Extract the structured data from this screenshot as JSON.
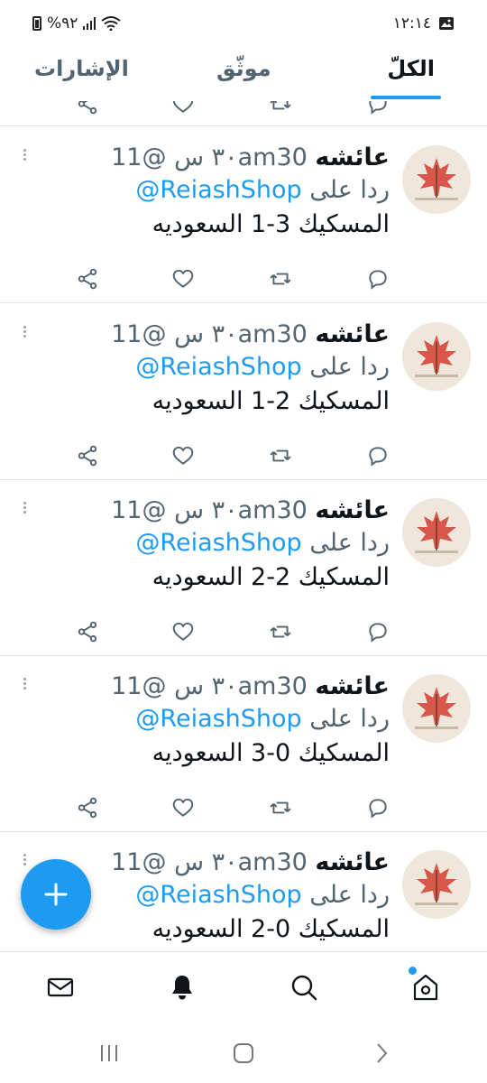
{
  "status_bar": {
    "time": "١٢:١٤",
    "battery": "%٩٢"
  },
  "tabs": [
    {
      "label": "الكلّ"
    },
    {
      "label": "موثّق"
    },
    {
      "label": "الإشارات"
    }
  ],
  "tweets": [
    {
      "name": "عائشه",
      "handle": "@11am30",
      "time": "٣٠ س",
      "reply_prefix": "ردا على",
      "mention": "@ReiashShop",
      "text": "المسكيك 3-1 السعوديه"
    },
    {
      "name": "عائشه",
      "handle": "@11am30",
      "time": "٣٠ س",
      "reply_prefix": "ردا على",
      "mention": "@ReiashShop",
      "text": "المسكيك 2-1 السعوديه"
    },
    {
      "name": "عائشه",
      "handle": "@11am30",
      "time": "٣٠ س",
      "reply_prefix": "ردا على",
      "mention": "@ReiashShop",
      "text": "المسكيك 2-2 السعوديه"
    },
    {
      "name": "عائشه",
      "handle": "@11am30",
      "time": "٣٠ س",
      "reply_prefix": "ردا على",
      "mention": "@ReiashShop",
      "text": "المسكيك 0-3 السعوديه"
    },
    {
      "name": "عائشه",
      "handle": "@11am30",
      "time": "٣٠ س",
      "reply_prefix": "ردا على",
      "mention": "@ReiashShop",
      "text": "المسكيك 0-2 السعوديه"
    }
  ],
  "icons": {
    "reply": "comment-icon",
    "retweet": "retweet-icon",
    "like": "heart-icon",
    "share": "share-icon",
    "compose": "plus-icon",
    "home": "home-icon",
    "search": "search-icon",
    "notifications": "bell-icon",
    "messages": "mail-icon"
  },
  "colors": {
    "accent": "#1d9bf0",
    "text": "#0f1419",
    "secondary": "#536471"
  }
}
